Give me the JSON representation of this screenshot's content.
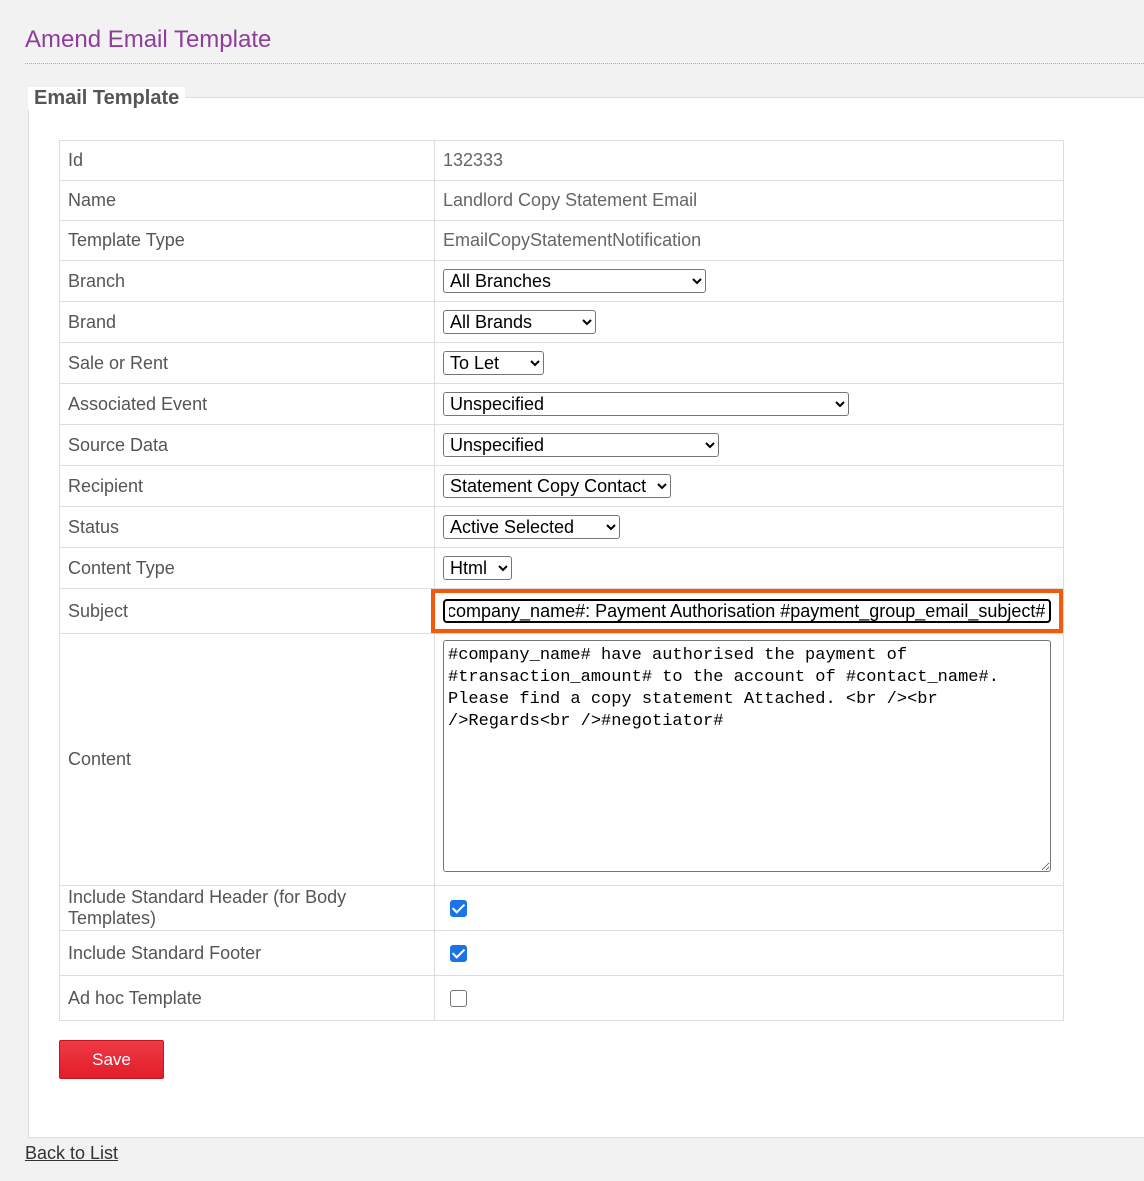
{
  "page": {
    "title": "Amend Email Template"
  },
  "section": {
    "legend": "Email Template"
  },
  "fields": {
    "id": {
      "label": "Id",
      "value": "132333"
    },
    "name": {
      "label": "Name",
      "value": "Landlord Copy Statement Email"
    },
    "template_type": {
      "label": "Template Type",
      "value": "EmailCopyStatementNotification"
    },
    "branch": {
      "label": "Branch",
      "selected": "All Branches"
    },
    "brand": {
      "label": "Brand",
      "selected": "All Brands"
    },
    "sale_or_rent": {
      "label": "Sale or Rent",
      "selected": "To Let"
    },
    "associated_event": {
      "label": "Associated Event",
      "selected": "Unspecified"
    },
    "source_data": {
      "label": "Source Data",
      "selected": "Unspecified"
    },
    "recipient": {
      "label": "Recipient",
      "selected": "Statement Copy Contact"
    },
    "status": {
      "label": "Status",
      "selected": "Active Selected"
    },
    "content_type": {
      "label": "Content Type",
      "selected": "Html"
    },
    "subject": {
      "label": "Subject",
      "value": "#company_name#: Payment Authorisation #payment_group_email_subject#"
    },
    "content": {
      "label": "Content",
      "value": "#company_name# have authorised the payment of #transaction_amount# to the account of #contact_name#. Please find a copy statement Attached. <br /><br />Regards<br />#negotiator#"
    },
    "include_header": {
      "label": "Include Standard Header (for Body Templates)",
      "checked": true
    },
    "include_footer": {
      "label": "Include Standard Footer",
      "checked": true
    },
    "ad_hoc": {
      "label": "Ad hoc Template",
      "checked": false
    }
  },
  "actions": {
    "save_label": "Save",
    "back_label": "Back to List"
  },
  "colors": {
    "title": "#8e3d9b",
    "save_button": "#e8262f",
    "highlight": "#f25a0c",
    "checkbox": "#1a73e8"
  }
}
